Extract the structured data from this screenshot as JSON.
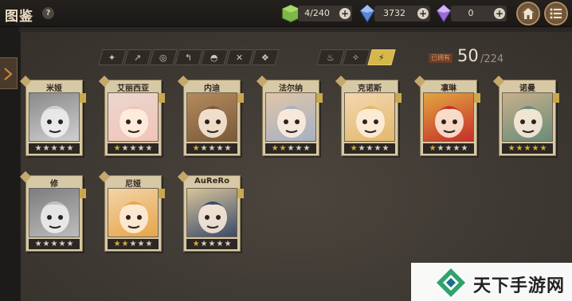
{
  "header": {
    "title": "图鉴",
    "help_glyph": "?",
    "resources": [
      {
        "name": "stamina",
        "icon": "green-cube-icon",
        "value": "4/240",
        "plus": "+"
      },
      {
        "name": "blue-crystal",
        "icon": "blue-crystal-icon",
        "value": "3732",
        "plus": "+"
      },
      {
        "name": "purple-crystal",
        "icon": "purple-crystal-icon",
        "value": "0",
        "plus": "+"
      }
    ]
  },
  "filters": {
    "weapon_types": [
      {
        "icon": "dagger-icon",
        "glyph": "✦"
      },
      {
        "icon": "spear-icon",
        "glyph": "↗"
      },
      {
        "icon": "shield-icon",
        "glyph": "◎"
      },
      {
        "icon": "scythe-icon",
        "glyph": "↰"
      },
      {
        "icon": "orb-icon",
        "glyph": "◓"
      },
      {
        "icon": "crossbow-icon",
        "glyph": "✕"
      },
      {
        "icon": "scroll-icon",
        "glyph": "❖"
      }
    ],
    "elements": [
      {
        "icon": "fire-icon",
        "glyph": "♨",
        "active": false
      },
      {
        "icon": "wind-icon",
        "glyph": "✧",
        "active": false
      },
      {
        "icon": "lightning-icon",
        "glyph": "⚡",
        "active": true
      }
    ]
  },
  "collection": {
    "owned_label": "已拥有",
    "count": "50",
    "total": "/224"
  },
  "characters": [
    {
      "name": "米娅",
      "stars": 5,
      "gold": 0,
      "locked": true
    },
    {
      "name": "艾丽西亚",
      "stars": 5,
      "gold": 1,
      "locked": false
    },
    {
      "name": "内迪",
      "stars": 5,
      "gold": 1,
      "locked": false
    },
    {
      "name": "法尔纳",
      "stars": 5,
      "gold": 2,
      "locked": false
    },
    {
      "name": "克诺斯",
      "stars": 5,
      "gold": 1,
      "locked": false
    },
    {
      "name": "凛琳",
      "stars": 5,
      "gold": 1,
      "locked": false
    },
    {
      "name": "诺曼",
      "stars": 5,
      "gold": 5,
      "locked": false
    },
    {
      "name": "修",
      "stars": 5,
      "gold": 0,
      "locked": true
    },
    {
      "name": "尼娅",
      "stars": 5,
      "gold": 2,
      "locked": false
    },
    {
      "name": "AuReRo",
      "stars": 5,
      "gold": 1,
      "locked": false
    }
  ],
  "colors": {
    "accent_gold": "#d6b74a",
    "card_paper": "#d7c8a6",
    "star_gold": "#d7a93c"
  },
  "watermark": {
    "text": "天下手游网"
  }
}
